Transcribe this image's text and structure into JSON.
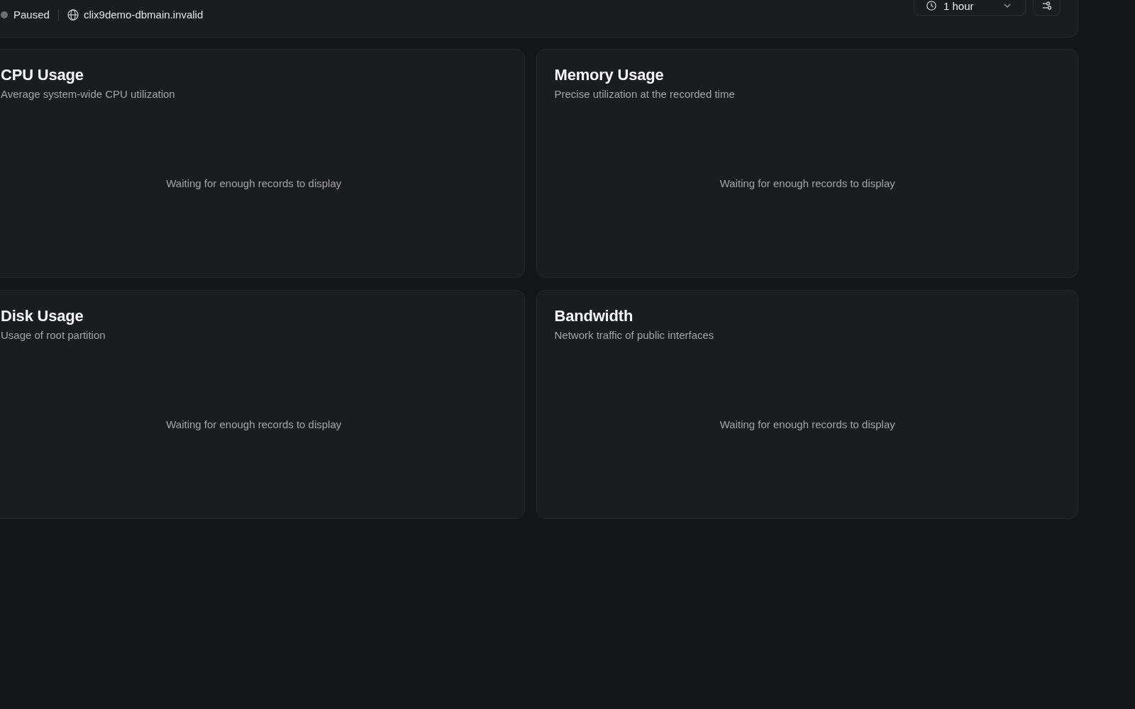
{
  "header": {
    "status": {
      "paused": true,
      "label": "Paused"
    },
    "host": "clix9demo-dbmain.invalid",
    "time_range": {
      "value": "1 hour"
    }
  },
  "cards": [
    {
      "title": "CPU Usage",
      "subtitle": "Average system-wide CPU utilization",
      "empty_message": "Waiting for enough records to display"
    },
    {
      "title": "Memory Usage",
      "subtitle": "Precise utilization at the recorded time",
      "empty_message": "Waiting for enough records to display"
    },
    {
      "title": "Disk Usage",
      "subtitle": "Usage of root partition",
      "empty_message": "Waiting for enough records to display"
    },
    {
      "title": "Bandwidth",
      "subtitle": "Network traffic of public interfaces",
      "empty_message": "Waiting for enough records to display"
    }
  ]
}
